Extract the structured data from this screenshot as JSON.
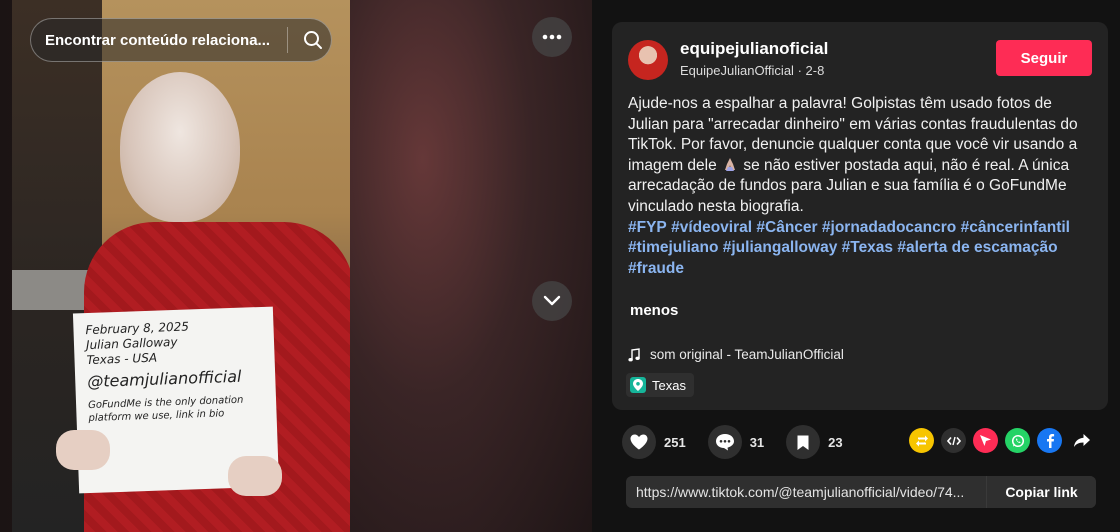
{
  "search": {
    "placeholder": "Encontrar conteúdo relaciona..."
  },
  "video": {
    "sign_lines": [
      "February 8, 2025",
      "Julian Galloway",
      "Texas - USA"
    ],
    "sign_handle": "@teamjulianofficial",
    "sign_note": "GoFundMe is the only donation platform we use, link in bio"
  },
  "author": {
    "username": "equipejulianoficial",
    "nickname": "EquipeJulianOfficial",
    "separator": " · ",
    "date": "2-8",
    "follow_label": "Seguir"
  },
  "description": {
    "text_before_emoji": "Ajude-nos a espalhar a palavra! Golpistas têm usado fotos de Julian para \"arrecadar dinheiro\" em várias contas fraudulentas do TikTok. Por favor, denuncie qualquer conta que você vir usando a imagem dele",
    "emoji": "folded-hands",
    "text_after_emoji": " se não estiver postada aqui, não é real. A única arrecadação de fundos para Julian e sua família é o GoFundMe vinculado nesta biografia.",
    "hashtags": [
      "#FYP",
      "#vídeoviral",
      "#Câncer",
      "#jornadadocancro",
      "#câncerinfantil",
      "#timejuliano",
      "#juliangalloway",
      "#Texas",
      "#alerta de escamação",
      "#fraude"
    ],
    "less_label": "menos"
  },
  "sound": {
    "label": "som original - TeamJulianOfficial"
  },
  "location": {
    "label": "Texas"
  },
  "stats": {
    "likes": "251",
    "comments": "31",
    "saves": "23"
  },
  "share_icons": [
    "repost-icon",
    "embed-icon",
    "send-icon",
    "whatsapp-icon",
    "facebook-icon",
    "share-arrow-icon"
  ],
  "link": {
    "url": "https://www.tiktok.com/@teamjulianofficial/video/74...",
    "copy_label": "Copiar link"
  },
  "colors": {
    "accent": "#fe2c55",
    "hashtag": "#8bb5f0",
    "location": "#16b59a",
    "whatsapp": "#25d366",
    "facebook": "#1877f2",
    "repost": "#f7c500"
  }
}
